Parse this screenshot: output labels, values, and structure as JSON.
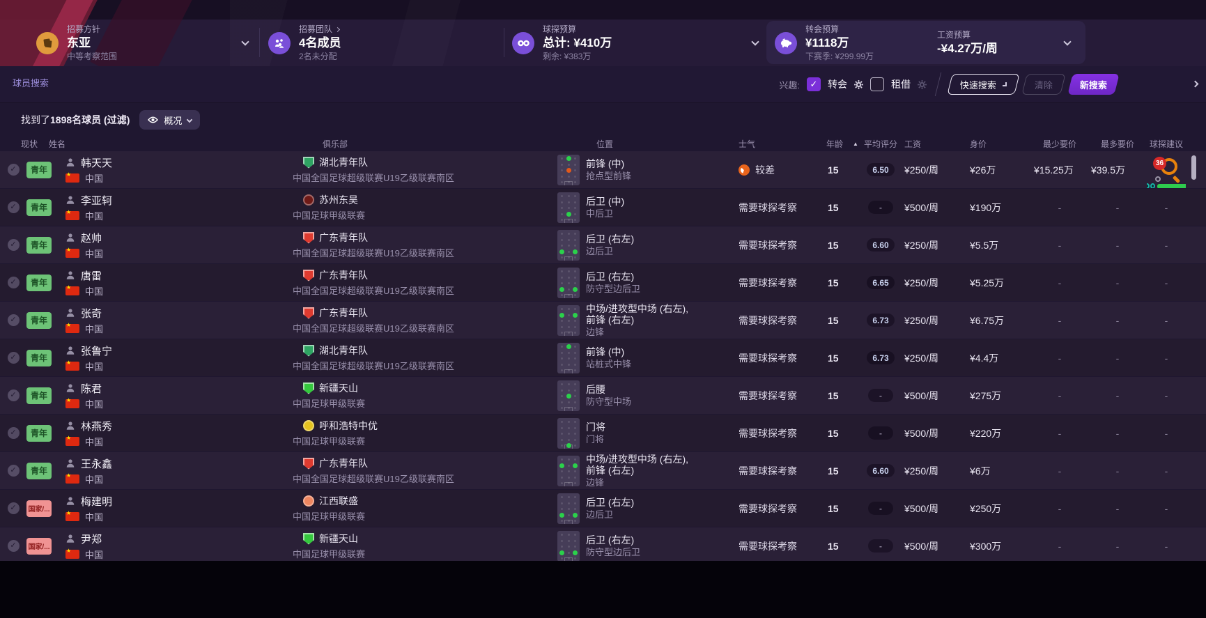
{
  "topbar": {
    "panels": [
      {
        "label": "招募方针",
        "value": "东亚",
        "sub": "中等考察范围"
      },
      {
        "label": "招募团队",
        "value": "4名成员",
        "sub": "2名未分配"
      },
      {
        "label": "球探预算",
        "value": "总计: ¥410万",
        "sub": "剩余: ¥383万"
      },
      {
        "label": "转会预算",
        "value": "¥1118万",
        "sub": "下赛季: ¥299.99万"
      },
      {
        "label": "工资预算",
        "value": "-¥4.27万/周",
        "sub": ""
      }
    ]
  },
  "search": {
    "title": "球员搜索",
    "interest_label": "兴趣:",
    "transfer_label": "转会",
    "transfer_checked": true,
    "loan_label": "租借",
    "loan_checked": false,
    "quick_search_label": "快速搜索",
    "clear_label": "清除",
    "new_search_label": "新搜索",
    "check_glyph": "✓"
  },
  "filter": {
    "found_prefix": "找到了",
    "found_count": "1898",
    "found_suffix": "名球员 (过滤)",
    "view_label": "概况"
  },
  "table": {
    "headers": [
      "现状",
      "姓名",
      "俱乐部",
      "位置",
      "士气",
      "年龄",
      "平均评分",
      "工资",
      "身价",
      "最少要价",
      "最多要价",
      "球探建议"
    ],
    "sort_arrow": "▲"
  },
  "colors": {
    "accent_purple": "#7b2fd9",
    "youth_badge": "#6dc377",
    "national_badge": "#f09393",
    "scout_badge_orange": "#e8820c",
    "scout_badge_red": "#d62828",
    "progress_green": "#2ecc4e",
    "dot_green": "#2bd14b",
    "dot_orange": "#e2591a"
  },
  "rows": [
    {
      "status": "青年",
      "status_type": "youth",
      "name": "韩天天",
      "nation": "中国",
      "club": "湖北青年队",
      "club_icon": {
        "shape": "shield",
        "color": "#2fa463"
      },
      "league": "中国全国足球超级联赛U19乙级联赛南区",
      "positions": [
        "前锋 (中)"
      ],
      "role": "抢点型前锋",
      "dots": [
        {
          "r": 0,
          "c": 1,
          "k": "g"
        },
        {
          "r": 2,
          "c": 1,
          "k": "o"
        }
      ],
      "morale": "较差",
      "morale_icon": true,
      "age": "15",
      "rating": "6.50",
      "wage": "¥250/周",
      "value": "¥26万",
      "min_price": "¥15.25万",
      "max_price": "¥39.5万",
      "scout": "",
      "scout_badge": "36",
      "scout_bar": true
    },
    {
      "status": "青年",
      "status_type": "youth",
      "name": "李亚轲",
      "nation": "中国",
      "club": "苏州东吴",
      "club_icon": {
        "shape": "circle",
        "color": "#6f1a17"
      },
      "league": "中国足球甲级联赛",
      "positions": [
        "后卫 (中)"
      ],
      "role": "中后卫",
      "dots": [
        {
          "r": 3,
          "c": 1,
          "k": "g"
        }
      ],
      "morale": "需要球探考察",
      "morale_icon": false,
      "age": "15",
      "rating": "-",
      "wage": "¥500/周",
      "value": "¥190万",
      "min_price": "-",
      "max_price": "-",
      "scout": "-",
      "scout_badge": "",
      "scout_bar": false
    },
    {
      "status": "青年",
      "status_type": "youth",
      "name": "赵帅",
      "nation": "中国",
      "club": "广东青年队",
      "club_icon": {
        "shape": "shield",
        "color": "#df3b30"
      },
      "league": "中国全国足球超级联赛U19乙级联赛南区",
      "positions": [
        "后卫 (右左)"
      ],
      "role": "边后卫",
      "dots": [
        {
          "r": 3,
          "c": 0,
          "k": "g"
        },
        {
          "r": 3,
          "c": 2,
          "k": "g"
        }
      ],
      "morale": "需要球探考察",
      "morale_icon": false,
      "age": "15",
      "rating": "6.60",
      "wage": "¥250/周",
      "value": "¥5.5万",
      "min_price": "-",
      "max_price": "-",
      "scout": "-",
      "scout_badge": "",
      "scout_bar": false
    },
    {
      "status": "青年",
      "status_type": "youth",
      "name": "唐雷",
      "nation": "中国",
      "club": "广东青年队",
      "club_icon": {
        "shape": "shield",
        "color": "#df3b30"
      },
      "league": "中国全国足球超级联赛U19乙级联赛南区",
      "positions": [
        "后卫 (右左)"
      ],
      "role": "防守型边后卫",
      "dots": [
        {
          "r": 3,
          "c": 0,
          "k": "g"
        },
        {
          "r": 3,
          "c": 2,
          "k": "g"
        }
      ],
      "morale": "需要球探考察",
      "morale_icon": false,
      "age": "15",
      "rating": "6.65",
      "wage": "¥250/周",
      "value": "¥5.25万",
      "min_price": "-",
      "max_price": "-",
      "scout": "-",
      "scout_badge": "",
      "scout_bar": false
    },
    {
      "status": "青年",
      "status_type": "youth",
      "name": "张奇",
      "nation": "中国",
      "club": "广东青年队",
      "club_icon": {
        "shape": "shield",
        "color": "#df3b30"
      },
      "league": "中国全国足球超级联赛U19乙级联赛南区",
      "positions": [
        "中场/进攻型中场 (右左),",
        "前锋 (右左)"
      ],
      "role": "边锋",
      "dots": [
        {
          "r": 1,
          "c": 0,
          "k": "g"
        },
        {
          "r": 1,
          "c": 2,
          "k": "g"
        }
      ],
      "morale": "需要球探考察",
      "morale_icon": false,
      "age": "15",
      "rating": "6.73",
      "wage": "¥250/周",
      "value": "¥6.75万",
      "min_price": "-",
      "max_price": "-",
      "scout": "-",
      "scout_badge": "",
      "scout_bar": false
    },
    {
      "status": "青年",
      "status_type": "youth",
      "name": "张鲁宁",
      "nation": "中国",
      "club": "湖北青年队",
      "club_icon": {
        "shape": "shield",
        "color": "#2fa463"
      },
      "league": "中国全国足球超级联赛U19乙级联赛南区",
      "positions": [
        "前锋 (中)"
      ],
      "role": "站桩式中锋",
      "dots": [
        {
          "r": 0,
          "c": 1,
          "k": "g"
        }
      ],
      "morale": "需要球探考察",
      "morale_icon": false,
      "age": "15",
      "rating": "6.73",
      "wage": "¥250/周",
      "value": "¥4.4万",
      "min_price": "-",
      "max_price": "-",
      "scout": "-",
      "scout_badge": "",
      "scout_bar": false
    },
    {
      "status": "青年",
      "status_type": "youth",
      "name": "陈君",
      "nation": "中国",
      "club": "新疆天山",
      "club_icon": {
        "shape": "shield",
        "color": "#35c83e"
      },
      "league": "中国足球甲级联赛",
      "positions": [
        "后腰"
      ],
      "role": "防守型中场",
      "dots": [
        {
          "r": 2,
          "c": 1,
          "k": "g"
        }
      ],
      "morale": "需要球探考察",
      "morale_icon": false,
      "age": "15",
      "rating": "-",
      "wage": "¥500/周",
      "value": "¥275万",
      "min_price": "-",
      "max_price": "-",
      "scout": "-",
      "scout_badge": "",
      "scout_bar": false
    },
    {
      "status": "青年",
      "status_type": "youth",
      "name": "林燕秀",
      "nation": "中国",
      "club": "呼和浩特中优",
      "club_icon": {
        "shape": "circle",
        "color": "#e5c320"
      },
      "league": "中国足球甲级联赛",
      "positions": [
        "门将"
      ],
      "role": "门将",
      "dots": [
        {
          "r": 4,
          "c": 1,
          "k": "g"
        }
      ],
      "morale": "需要球探考察",
      "morale_icon": false,
      "age": "15",
      "rating": "-",
      "wage": "¥500/周",
      "value": "¥220万",
      "min_price": "-",
      "max_price": "-",
      "scout": "-",
      "scout_badge": "",
      "scout_bar": false
    },
    {
      "status": "青年",
      "status_type": "youth",
      "name": "王永鑫",
      "nation": "中国",
      "club": "广东青年队",
      "club_icon": {
        "shape": "shield",
        "color": "#df3b30"
      },
      "league": "中国全国足球超级联赛U19乙级联赛南区",
      "positions": [
        "中场/进攻型中场 (右左),",
        "前锋 (右左)"
      ],
      "role": "边锋",
      "dots": [
        {
          "r": 1,
          "c": 0,
          "k": "g"
        },
        {
          "r": 1,
          "c": 2,
          "k": "g"
        }
      ],
      "morale": "需要球探考察",
      "morale_icon": false,
      "age": "15",
      "rating": "6.60",
      "wage": "¥250/周",
      "value": "¥6万",
      "min_price": "-",
      "max_price": "-",
      "scout": "-",
      "scout_badge": "",
      "scout_bar": false
    },
    {
      "status": "国家/...",
      "status_type": "national",
      "name": "梅建明",
      "nation": "中国",
      "club": "江西联盛",
      "club_icon": {
        "shape": "circle",
        "color": "#ee8660"
      },
      "league": "中国足球甲级联赛",
      "positions": [
        "后卫 (右左)"
      ],
      "role": "边后卫",
      "dots": [
        {
          "r": 3,
          "c": 0,
          "k": "g"
        },
        {
          "r": 3,
          "c": 2,
          "k": "g"
        }
      ],
      "morale": "需要球探考察",
      "morale_icon": false,
      "age": "15",
      "rating": "-",
      "wage": "¥500/周",
      "value": "¥250万",
      "min_price": "-",
      "max_price": "-",
      "scout": "-",
      "scout_badge": "",
      "scout_bar": false
    },
    {
      "status": "国家/...",
      "status_type": "national",
      "name": "尹郑",
      "nation": "中国",
      "club": "新疆天山",
      "club_icon": {
        "shape": "shield",
        "color": "#35c83e"
      },
      "league": "中国足球甲级联赛",
      "positions": [
        "后卫 (右左)"
      ],
      "role": "防守型边后卫",
      "dots": [
        {
          "r": 3,
          "c": 0,
          "k": "g"
        },
        {
          "r": 3,
          "c": 2,
          "k": "g"
        }
      ],
      "morale": "需要球探考察",
      "morale_icon": false,
      "age": "15",
      "rating": "-",
      "wage": "¥500/周",
      "value": "¥300万",
      "min_price": "-",
      "max_price": "-",
      "scout": "-",
      "scout_badge": "",
      "scout_bar": false
    }
  ]
}
